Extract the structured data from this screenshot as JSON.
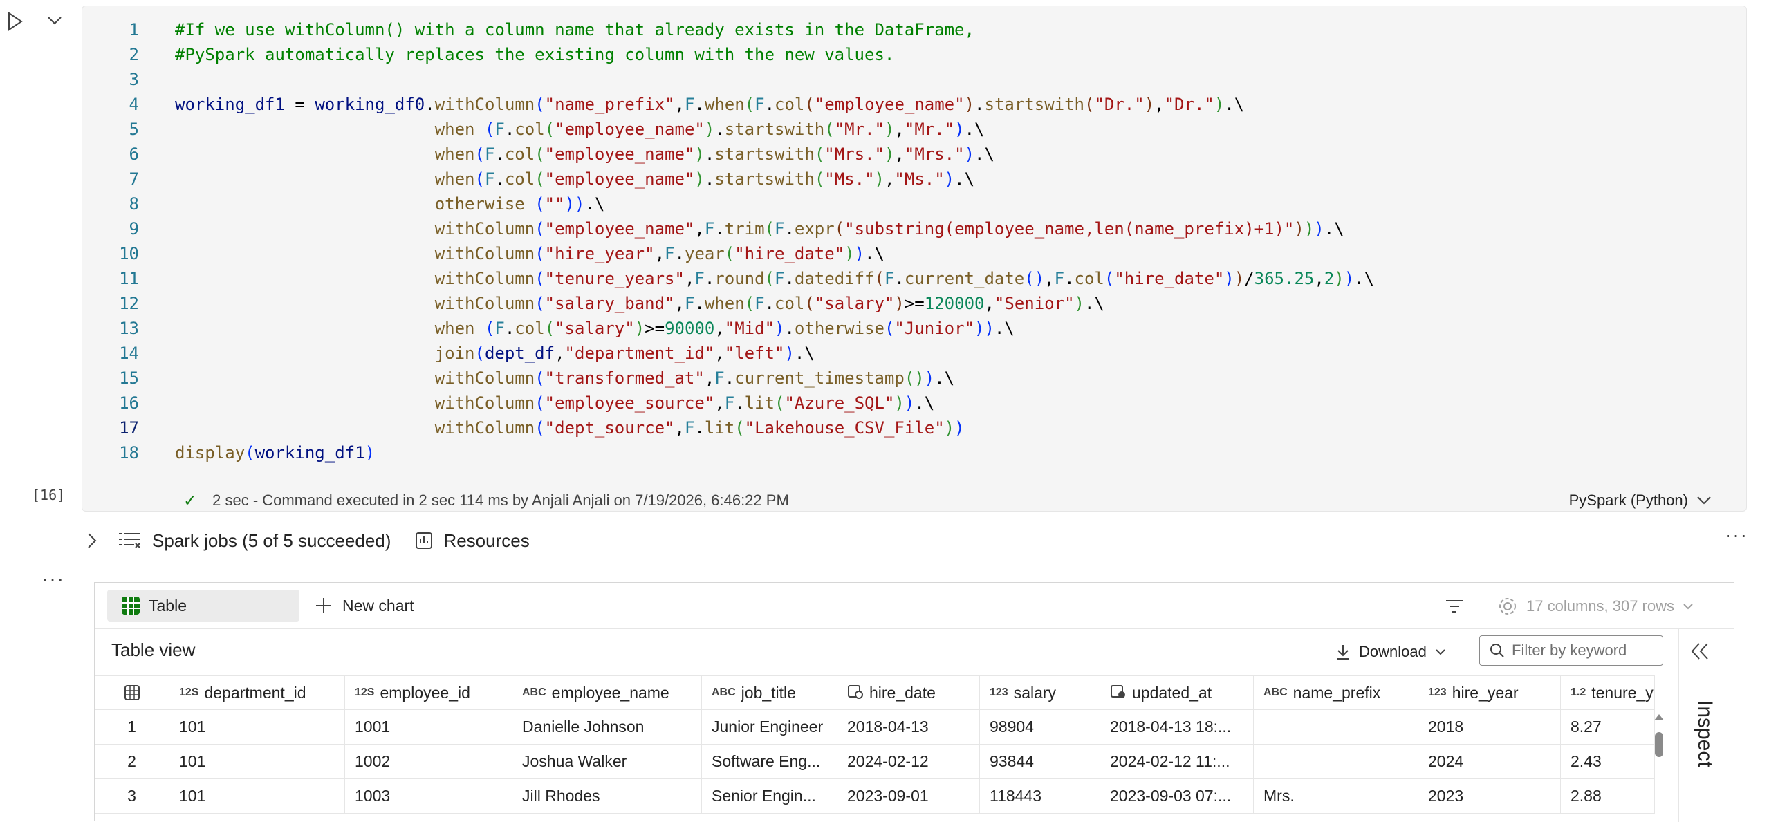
{
  "cell": {
    "execution_count": "[16]",
    "code_lines": [
      {
        "n": "1",
        "t": "#If we use withColumn() with a column name that already exists in the DataFrame,"
      },
      {
        "n": "2",
        "t": "#PySpark automatically replaces the existing column with the new values."
      },
      {
        "n": "3",
        "t": ""
      },
      {
        "n": "4",
        "t": "working_df1 = working_df0.withColumn(\"name_prefix\",F.when(F.col(\"employee_name\").startswith(\"Dr.\"),\"Dr.\").\\"
      },
      {
        "n": "5",
        "t": "                          when (F.col(\"employee_name\").startswith(\"Mr.\"),\"Mr.\").\\"
      },
      {
        "n": "6",
        "t": "                          when(F.col(\"employee_name\").startswith(\"Mrs.\"),\"Mrs.\").\\"
      },
      {
        "n": "7",
        "t": "                          when(F.col(\"employee_name\").startswith(\"Ms.\"),\"Ms.\").\\"
      },
      {
        "n": "8",
        "t": "                          otherwise (\"\")).\\"
      },
      {
        "n": "9",
        "t": "                          withColumn(\"employee_name\",F.trim(F.expr(\"substring(employee_name,len(name_prefix)+1)\"))).\\"
      },
      {
        "n": "10",
        "t": "                          withColumn(\"hire_year\",F.year(\"hire_date\")).\\"
      },
      {
        "n": "11",
        "t": "                          withColumn(\"tenure_years\",F.round(F.datediff(F.current_date(),F.col(\"hire_date\"))/365.25,2)).\\"
      },
      {
        "n": "12",
        "t": "                          withColumn(\"salary_band\",F.when(F.col(\"salary\")>=120000,\"Senior\").\\"
      },
      {
        "n": "13",
        "t": "                          when (F.col(\"salary\")>=90000,\"Mid\").otherwise(\"Junior\")).\\"
      },
      {
        "n": "14",
        "t": "                          join(dept_df,\"department_id\",\"left\").\\"
      },
      {
        "n": "15",
        "t": "                          withColumn(\"transformed_at\",F.current_timestamp()).\\"
      },
      {
        "n": "16",
        "t": "                          withColumn(\"employee_source\",F.lit(\"Azure_SQL\")).\\"
      },
      {
        "n": "17",
        "t": "                          withColumn(\"dept_source\",F.lit(\"Lakehouse_CSV_File\"))"
      },
      {
        "n": "18",
        "t": "display(working_df1)"
      }
    ],
    "status": {
      "duration": "2 sec",
      "message": "- Command executed in 2 sec 114 ms by Anjali Anjali on 7/19/2026, 6:46:22 PM"
    },
    "language": "PySpark (Python)"
  },
  "spark_bar": {
    "jobs_label": "Spark jobs (5 of 5 succeeded)",
    "resources_label": "Resources"
  },
  "more_glyph": "···",
  "output": {
    "table_tab_label": "Table",
    "new_chart_label": "New chart",
    "summary": "17 columns, 307 rows",
    "table_view_title": "Table view",
    "download_label": "Download",
    "filter_placeholder": "Filter by keyword",
    "inspect_label": "Inspect",
    "columns": [
      {
        "type": "12S",
        "name": "department_id"
      },
      {
        "type": "12S",
        "name": "employee_id"
      },
      {
        "type": "ABC",
        "name": "employee_name"
      },
      {
        "type": "ABC",
        "name": "job_title"
      },
      {
        "type": "date-icon",
        "name": "hire_date"
      },
      {
        "type": "123",
        "name": "salary"
      },
      {
        "type": "datetime-icon",
        "name": "updated_at"
      },
      {
        "type": "ABC",
        "name": "name_prefix"
      },
      {
        "type": "123",
        "name": "hire_year"
      },
      {
        "type": "1.2",
        "name": "tenure_ye"
      }
    ],
    "rows": [
      {
        "idx": "1",
        "cells": [
          "101",
          "1001",
          "Danielle Johnson",
          "Junior Engineer",
          "2018-04-13",
          "98904",
          "2018-04-13 18:...",
          "",
          "2018",
          "8.27"
        ]
      },
      {
        "idx": "2",
        "cells": [
          "101",
          "1002",
          "Joshua Walker",
          "Software Eng...",
          "2024-02-12",
          "93844",
          "2024-02-12 11:...",
          "",
          "2024",
          "2.43"
        ]
      },
      {
        "idx": "3",
        "cells": [
          "101",
          "1003",
          "Jill Rhodes",
          "Senior Engin...",
          "2023-09-01",
          "118443",
          "2023-09-03 07:...",
          "Mrs.",
          "2023",
          "2.88"
        ]
      }
    ]
  },
  "colors": {
    "comment": "#008000",
    "variable": "#001080",
    "function": "#795e26",
    "string": "#a31515",
    "number": "#098658",
    "module": "#267f99",
    "line_number": "#237893",
    "success": "#107c10"
  }
}
